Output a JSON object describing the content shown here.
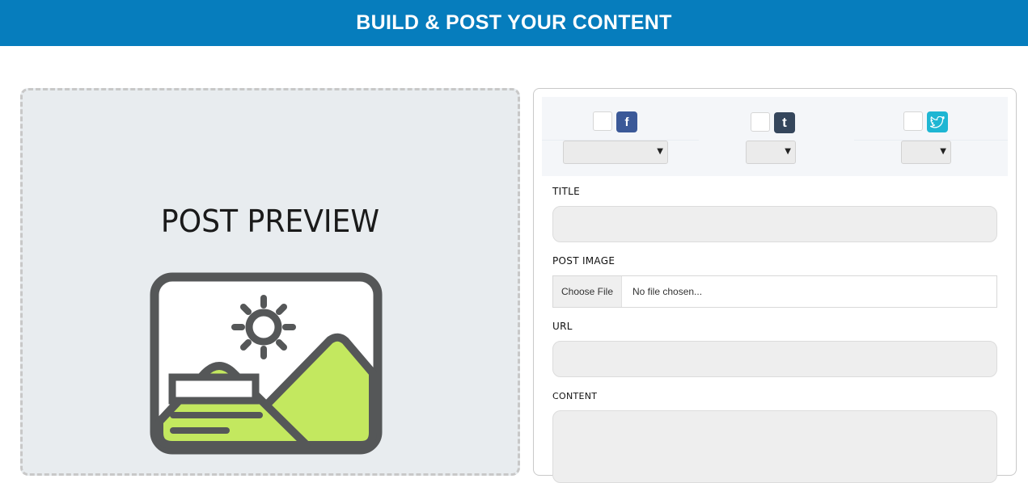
{
  "header": {
    "title": "BUILD & POST YOUR CONTENT"
  },
  "preview": {
    "title": "POST PREVIEW",
    "icon": "image-placeholder-icon"
  },
  "social": {
    "networks": [
      {
        "name": "facebook",
        "glyph": "f",
        "color": "#3b5998",
        "icon": "facebook-icon",
        "selected": ""
      },
      {
        "name": "tumblr",
        "glyph": "t",
        "color": "#35465c",
        "icon": "tumblr-icon",
        "selected": ""
      },
      {
        "name": "twitter",
        "glyph": "",
        "color": "#1eb6d3",
        "icon": "twitter-icon",
        "selected": ""
      }
    ],
    "caret": "▼"
  },
  "form": {
    "title_label": "TITLE",
    "title_value": "",
    "image_label": "POST IMAGE",
    "choose_file": "Choose File",
    "no_file": "No file chosen...",
    "url_label": "URL",
    "url_value": "",
    "content_label": "CONTENT",
    "content_value": ""
  },
  "colors": {
    "banner": "#067dbd",
    "preview_bg": "#e8ecef",
    "icon_green": "#c3e85f",
    "icon_dark": "#555758"
  }
}
